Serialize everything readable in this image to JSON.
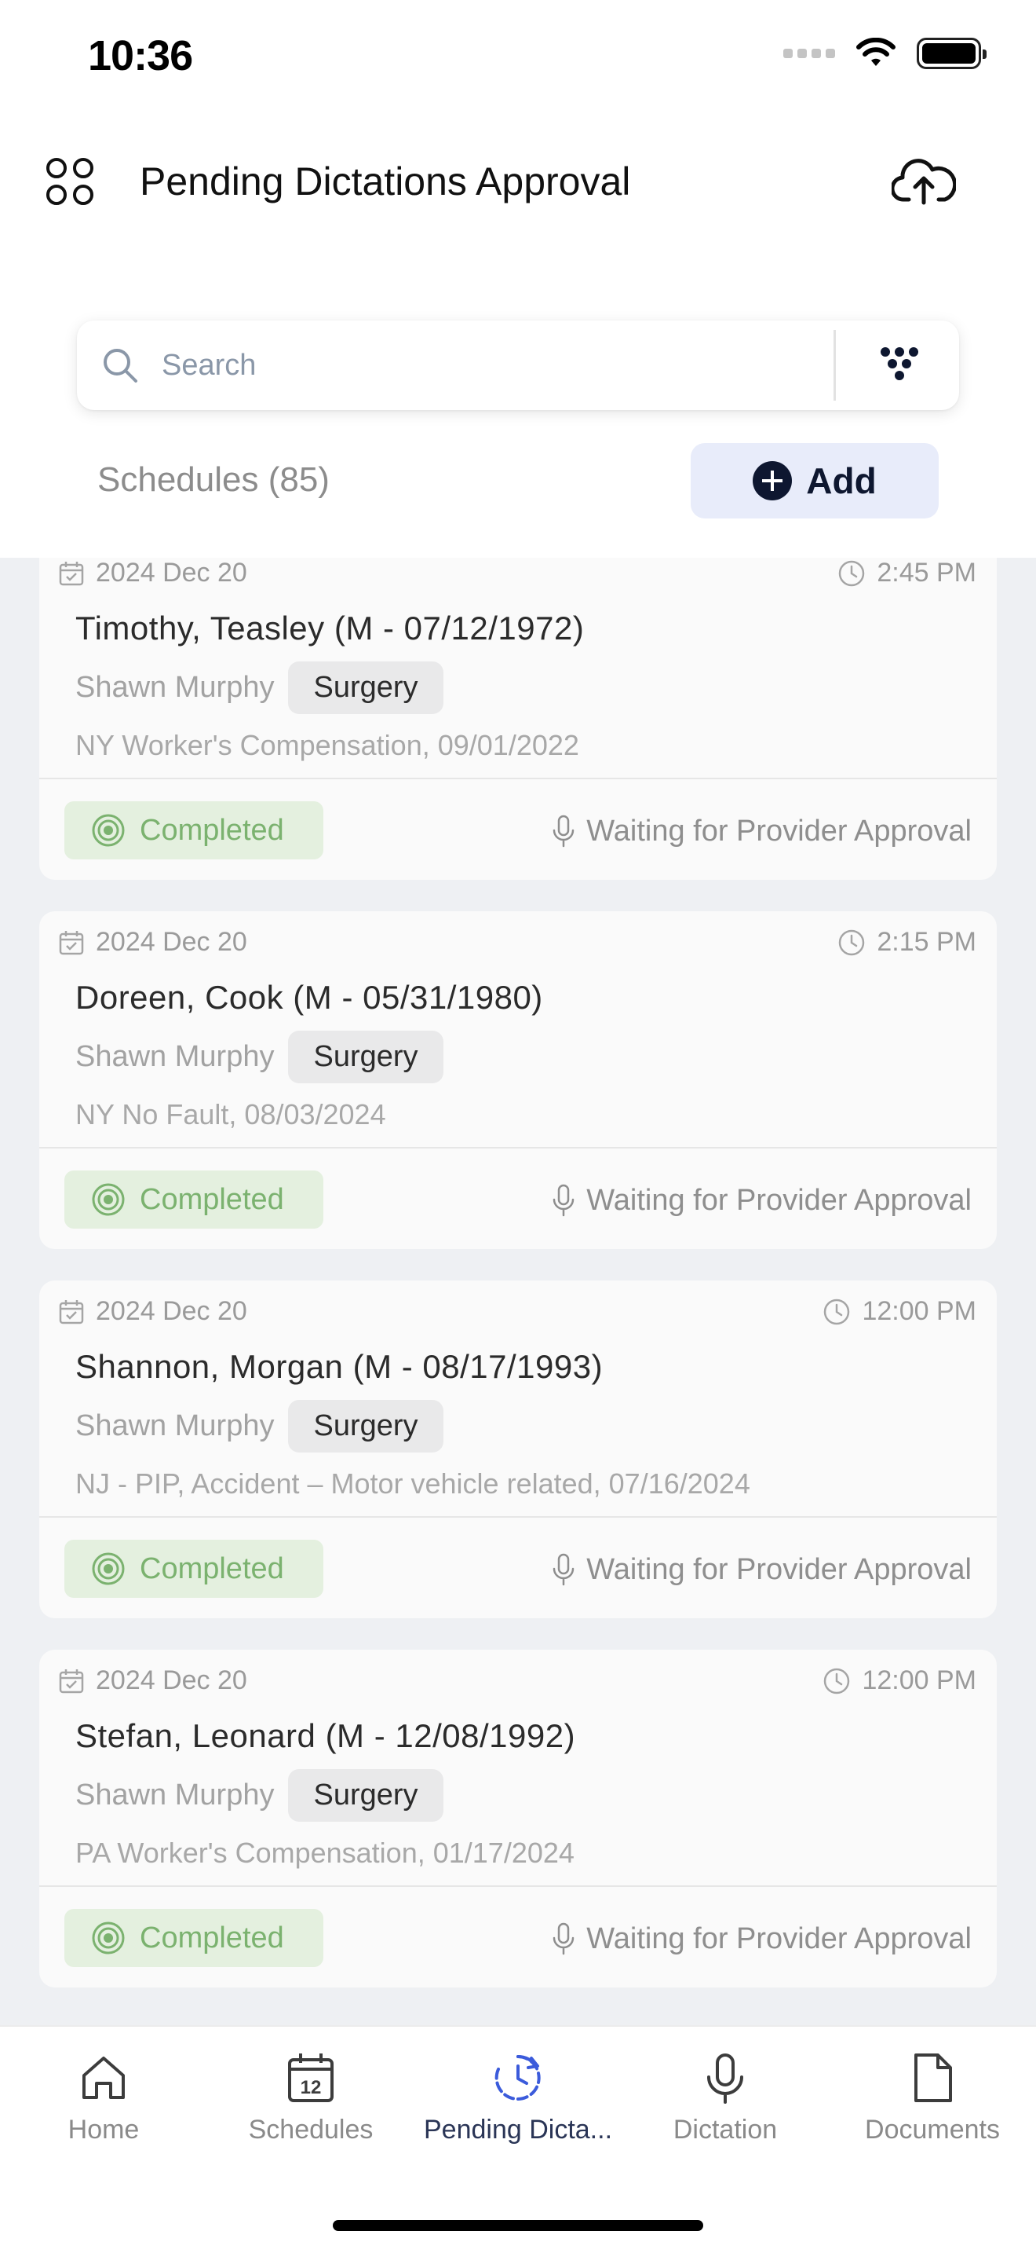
{
  "status_bar": {
    "time": "10:36"
  },
  "header": {
    "title": "Pending Dictations Approval"
  },
  "search": {
    "placeholder": "Search"
  },
  "schedules": {
    "count_label": "Schedules (85)",
    "add_label": "Add"
  },
  "cards": [
    {
      "date": "2024 Dec 20",
      "time": "2:45 PM",
      "patient": "Timothy, Teasley (M - 07/12/1972)",
      "provider": "Shawn Murphy",
      "department": "Surgery",
      "insurance": "NY Worker's Compensation, 09/01/2022",
      "status": "Completed",
      "approval": "Waiting for Provider Approval"
    },
    {
      "date": "2024 Dec 20",
      "time": "2:15 PM",
      "patient": "Doreen, Cook (M - 05/31/1980)",
      "provider": "Shawn Murphy",
      "department": "Surgery",
      "insurance": "NY No Fault, 08/03/2024",
      "status": "Completed",
      "approval": "Waiting for Provider Approval"
    },
    {
      "date": "2024 Dec 20",
      "time": "12:00 PM",
      "patient": "Shannon, Morgan (M - 08/17/1993)",
      "provider": "Shawn Murphy",
      "department": "Surgery",
      "insurance": "NJ - PIP, Accident – Motor vehicle related, 07/16/2024",
      "status": "Completed",
      "approval": "Waiting for Provider Approval"
    },
    {
      "date": "2024 Dec 20",
      "time": "12:00 PM",
      "patient": "Stefan, Leonard (M - 12/08/1992)",
      "provider": "Shawn Murphy",
      "department": "Surgery",
      "insurance": "PA Worker's Compensation, 01/17/2024",
      "status": "Completed",
      "approval": "Waiting for Provider Approval"
    }
  ],
  "tabs": [
    {
      "label": "Home",
      "icon": "home-icon"
    },
    {
      "label": "Schedules",
      "icon": "calendar-icon"
    },
    {
      "label": "Pending Dicta...",
      "icon": "clock-refresh-icon"
    },
    {
      "label": "Dictation",
      "icon": "microphone-icon"
    },
    {
      "label": "Documents",
      "icon": "document-icon"
    }
  ],
  "colors": {
    "accent": "#0e1730",
    "active_tab": "#3b5bdb",
    "completed_green": "#7bb26f",
    "completed_bg": "#e4f0df",
    "add_bg": "#e8ecfa"
  }
}
